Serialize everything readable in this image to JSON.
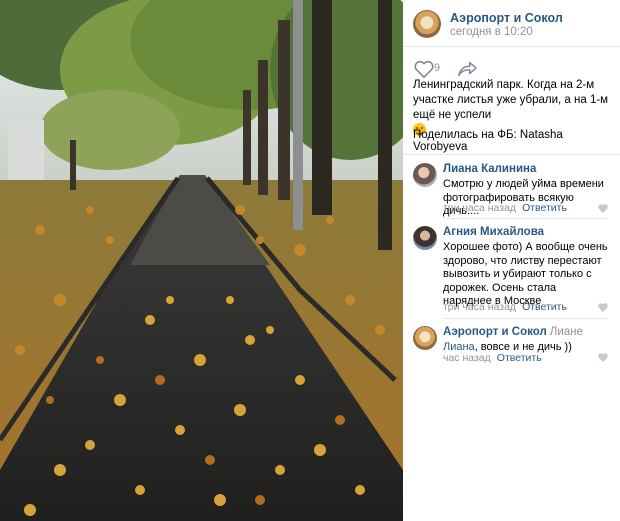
{
  "post": {
    "author": "Аэропорт и Сокол",
    "time": "сегодня в 10:20",
    "likes": "9",
    "text": "Ленинградский парк. Когда на 2-м участке листья уже убрали, а на 1-м ещё не успели",
    "shared": "Поделилась на ФБ: Natasha Vorobyeva"
  },
  "comments": [
    {
      "author": "Лиана Калинина",
      "text": "Смотрю у людей уйма времени фотографировать всякую дичь....",
      "time": "три часа назад",
      "reply": "Ответить"
    },
    {
      "author": "Агния Михайлова",
      "text": "Хорошее фото) А вообще очень здорово, что листву перестают вывозить и убирают только с дорожек. Осень стала наряднее в Москве",
      "time": "три часа назад",
      "reply": "Ответить"
    },
    {
      "author": "Аэропорт и Сокол",
      "reply_to": "Лиане",
      "mention": "Лиана",
      "text": ", вовсе и не дичь ))",
      "time": "час назад",
      "reply": "Ответить"
    }
  ],
  "colors": {
    "link": "#2a5885",
    "muted": "#939393",
    "divider": "#e7e8ec"
  },
  "icons": [
    "heart-icon",
    "share-arrow-icon",
    "small-heart-icon",
    "smile-emoji-icon"
  ]
}
